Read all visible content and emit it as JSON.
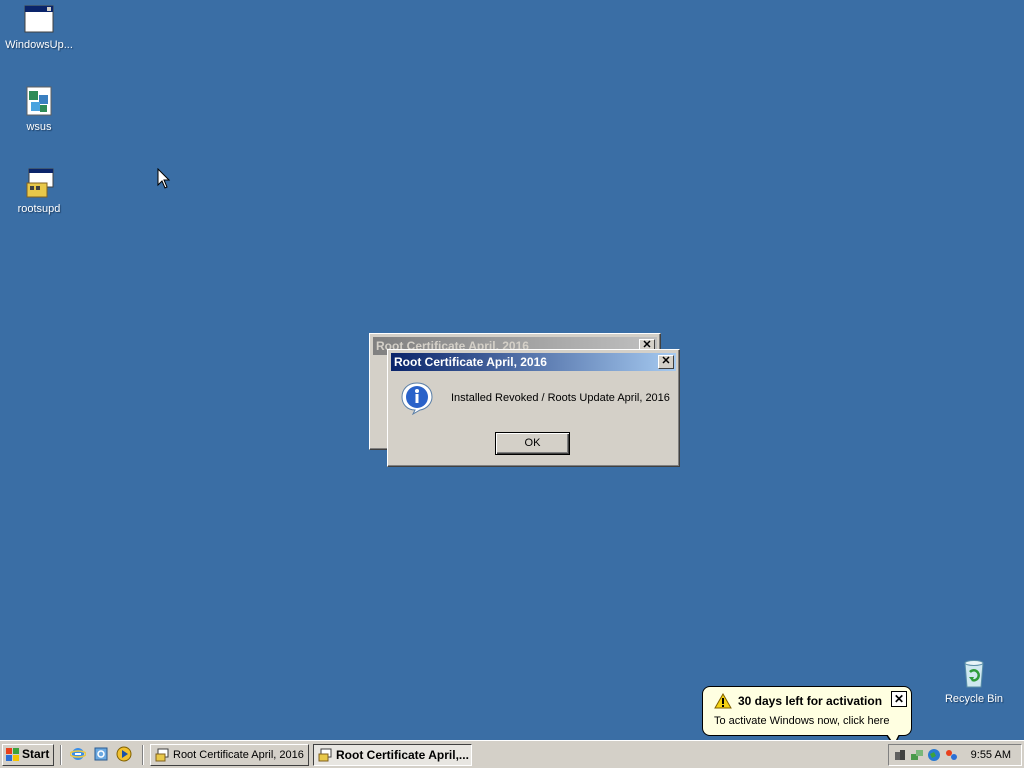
{
  "desktop": {
    "icons": [
      {
        "label": "WindowsUp..."
      },
      {
        "label": "wsus"
      },
      {
        "label": "rootsupd"
      },
      {
        "label": "Recycle Bin"
      }
    ]
  },
  "background_window": {
    "title": "Root Certificate April, 2016",
    "close_glyph": "✕"
  },
  "dialog": {
    "title": "Root Certificate April, 2016",
    "message": "Installed Revoked / Roots Update April, 2016",
    "ok_label": "OK",
    "close_glyph": "✕",
    "icon": "info-icon"
  },
  "balloon": {
    "title": "30 days left for activation",
    "text": "To activate Windows now, click here",
    "close_glyph": "✕",
    "icon": "warning-icon"
  },
  "taskbar": {
    "start_label": "Start",
    "tasks": [
      {
        "label": "Root Certificate April, 2016"
      },
      {
        "label": "Root Certificate April,..."
      }
    ],
    "clock": "9:55 AM"
  },
  "colors": {
    "desktop": "#3a6ea5",
    "title_active": "#0a246a",
    "balloon_bg": "#ffffe1"
  }
}
